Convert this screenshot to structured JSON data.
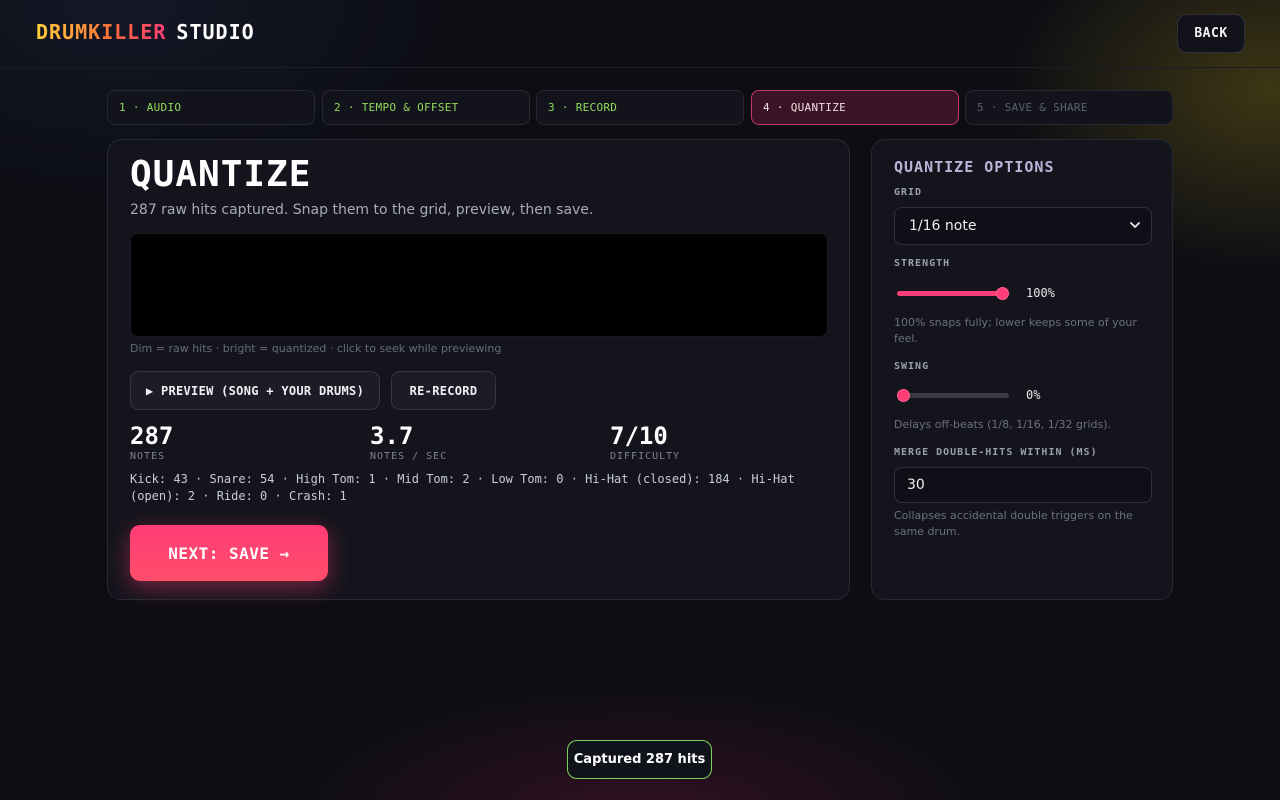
{
  "header": {
    "brand": "DRUMKILLER",
    "studio": "STUDIO",
    "back_label": "BACK"
  },
  "steps": [
    {
      "label": "1 · AUDIO",
      "state": "done"
    },
    {
      "label": "2 · TEMPO & OFFSET",
      "state": "done"
    },
    {
      "label": "3 · RECORD",
      "state": "done"
    },
    {
      "label": "4 · QUANTIZE",
      "state": "active"
    },
    {
      "label": "5 · SAVE & SHARE",
      "state": "pending"
    }
  ],
  "main": {
    "title": "QUANTIZE",
    "subtitle": "287 raw hits captured. Snap them to the grid, preview, then save.",
    "waveform_hint": "Dim = raw hits · bright = quantized · click to seek while previewing",
    "preview_label": "▶ PREVIEW (SONG + YOUR DRUMS)",
    "rerecord_label": "RE-RECORD",
    "stats": {
      "notes_value": "287",
      "notes_label": "NOTES",
      "rate_value": "3.7",
      "rate_label": "NOTES / SEC",
      "difficulty_value": "7/10",
      "difficulty_label": "DIFFICULTY"
    },
    "breakdown": "Kick: 43 · Snare: 54 · High Tom: 1 · Mid Tom: 2 · Low Tom: 0 · Hi-Hat (closed): 184 · Hi-Hat (open): 2 · Ride: 0 · Crash: 1",
    "next_label": "NEXT: SAVE →"
  },
  "options": {
    "title": "QUANTIZE OPTIONS",
    "grid_label": "GRID",
    "grid_value": "1/16 note",
    "strength_label": "STRENGTH",
    "strength_value": "100%",
    "strength_fraction": 1.0,
    "strength_hint": "100% snaps fully; lower keeps some of your feel.",
    "swing_label": "SWING",
    "swing_value": "0%",
    "swing_fraction": 0.0,
    "swing_hint": "Delays off-beats (1/8, 1/16, 1/32 grids).",
    "merge_label": "MERGE DOUBLE-HITS WITHIN (MS)",
    "merge_value": "30",
    "merge_hint": "Collapses accidental double triggers on the same drum."
  },
  "toast": "Captured 287 hits",
  "colors": {
    "accent": "#ff3d76",
    "done_step": "#8fdc5c",
    "toast_border": "#7fd35a"
  }
}
